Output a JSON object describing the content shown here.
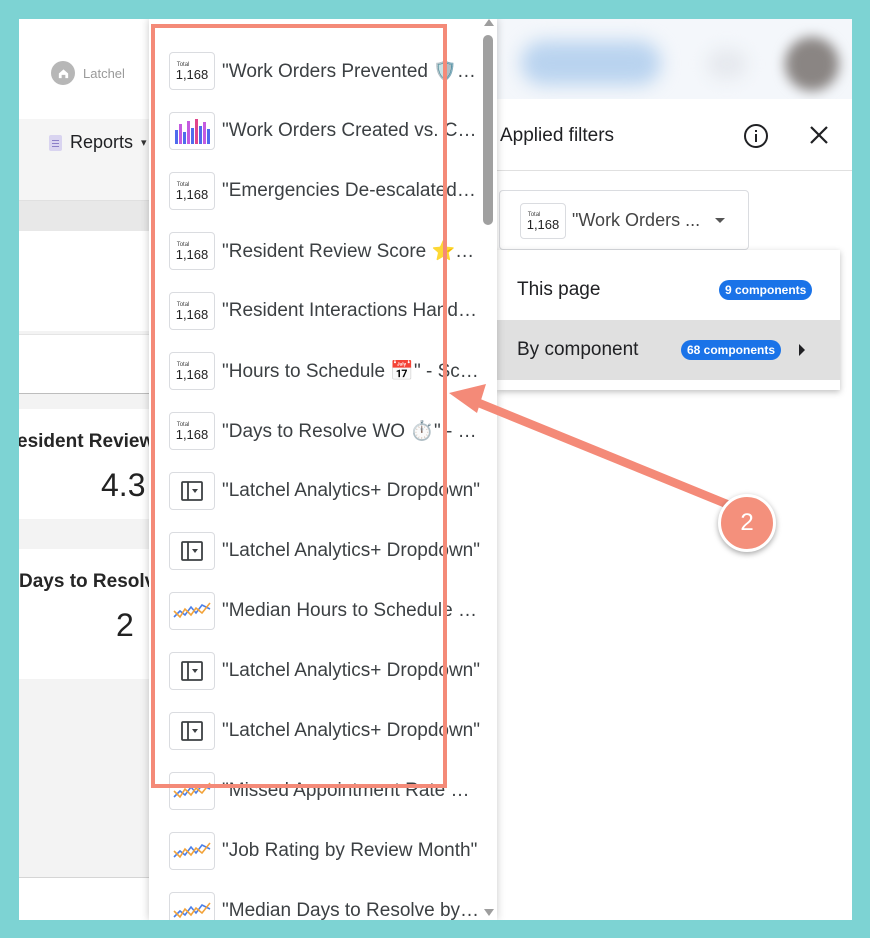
{
  "app": {
    "logo_text": "Latchel",
    "nav_label": "Reports",
    "caret_glyph": "▾"
  },
  "report": {
    "kpis": [
      {
        "title": "esident Review",
        "value": "4.3"
      },
      {
        "title": "Days to Resolv",
        "value": "2"
      }
    ]
  },
  "component_list": {
    "items": [
      {
        "icon": "scorecard-icon",
        "label": "\"Work Orders Prevented 🛡️\" - Scorecard"
      },
      {
        "icon": "bar-chart-icon",
        "label": "\"Work Orders Created vs. Completed\""
      },
      {
        "icon": "scorecard-icon",
        "label": "\"Emergencies De-escalated\" - Scorecard"
      },
      {
        "icon": "scorecard-icon",
        "label": "\"Resident Review Score ⭐\" - Scorecard"
      },
      {
        "icon": "scorecard-icon",
        "label": "\"Resident Interactions Handled\" - Scorecard"
      },
      {
        "icon": "scorecard-icon",
        "label": "\"Hours to Schedule 📅\" - Scorecard"
      },
      {
        "icon": "scorecard-icon",
        "label": "\"Days to Resolve WO ⏱️\" - Scorecard"
      },
      {
        "icon": "dropdown-control-icon",
        "label": "\"Latchel Analytics+ Dropdown\""
      },
      {
        "icon": "dropdown-control-icon",
        "label": "\"Latchel Analytics+ Dropdown\""
      },
      {
        "icon": "line-chart-icon",
        "label": "\"Median Hours to Schedule by Month\""
      },
      {
        "icon": "dropdown-control-icon",
        "label": "\"Latchel Analytics+ Dropdown\""
      },
      {
        "icon": "dropdown-control-icon",
        "label": "\"Latchel Analytics+ Dropdown\""
      },
      {
        "icon": "line-chart-icon",
        "label": "\"Missed Appointment Rate by Month\""
      },
      {
        "icon": "line-chart-icon",
        "label": "\"Job Rating by Review Month\""
      },
      {
        "icon": "line-chart-icon",
        "label": "\"Median Days to Resolve by Month\""
      }
    ],
    "scorecard_icon": {
      "caption": "Total",
      "value": "1,168"
    }
  },
  "filters_panel": {
    "title": "Applied filters",
    "selected_component": "\"Work Orders ...",
    "scope_options": [
      {
        "label": "This page",
        "badge": "9 components",
        "selected": false
      },
      {
        "label": "By component",
        "badge": "68 components",
        "selected": true
      }
    ]
  },
  "annotation": {
    "step_number": "2"
  },
  "colors": {
    "frame": "#7dd3d3",
    "highlight": "#f48a78",
    "badge": "#1a73e8"
  }
}
